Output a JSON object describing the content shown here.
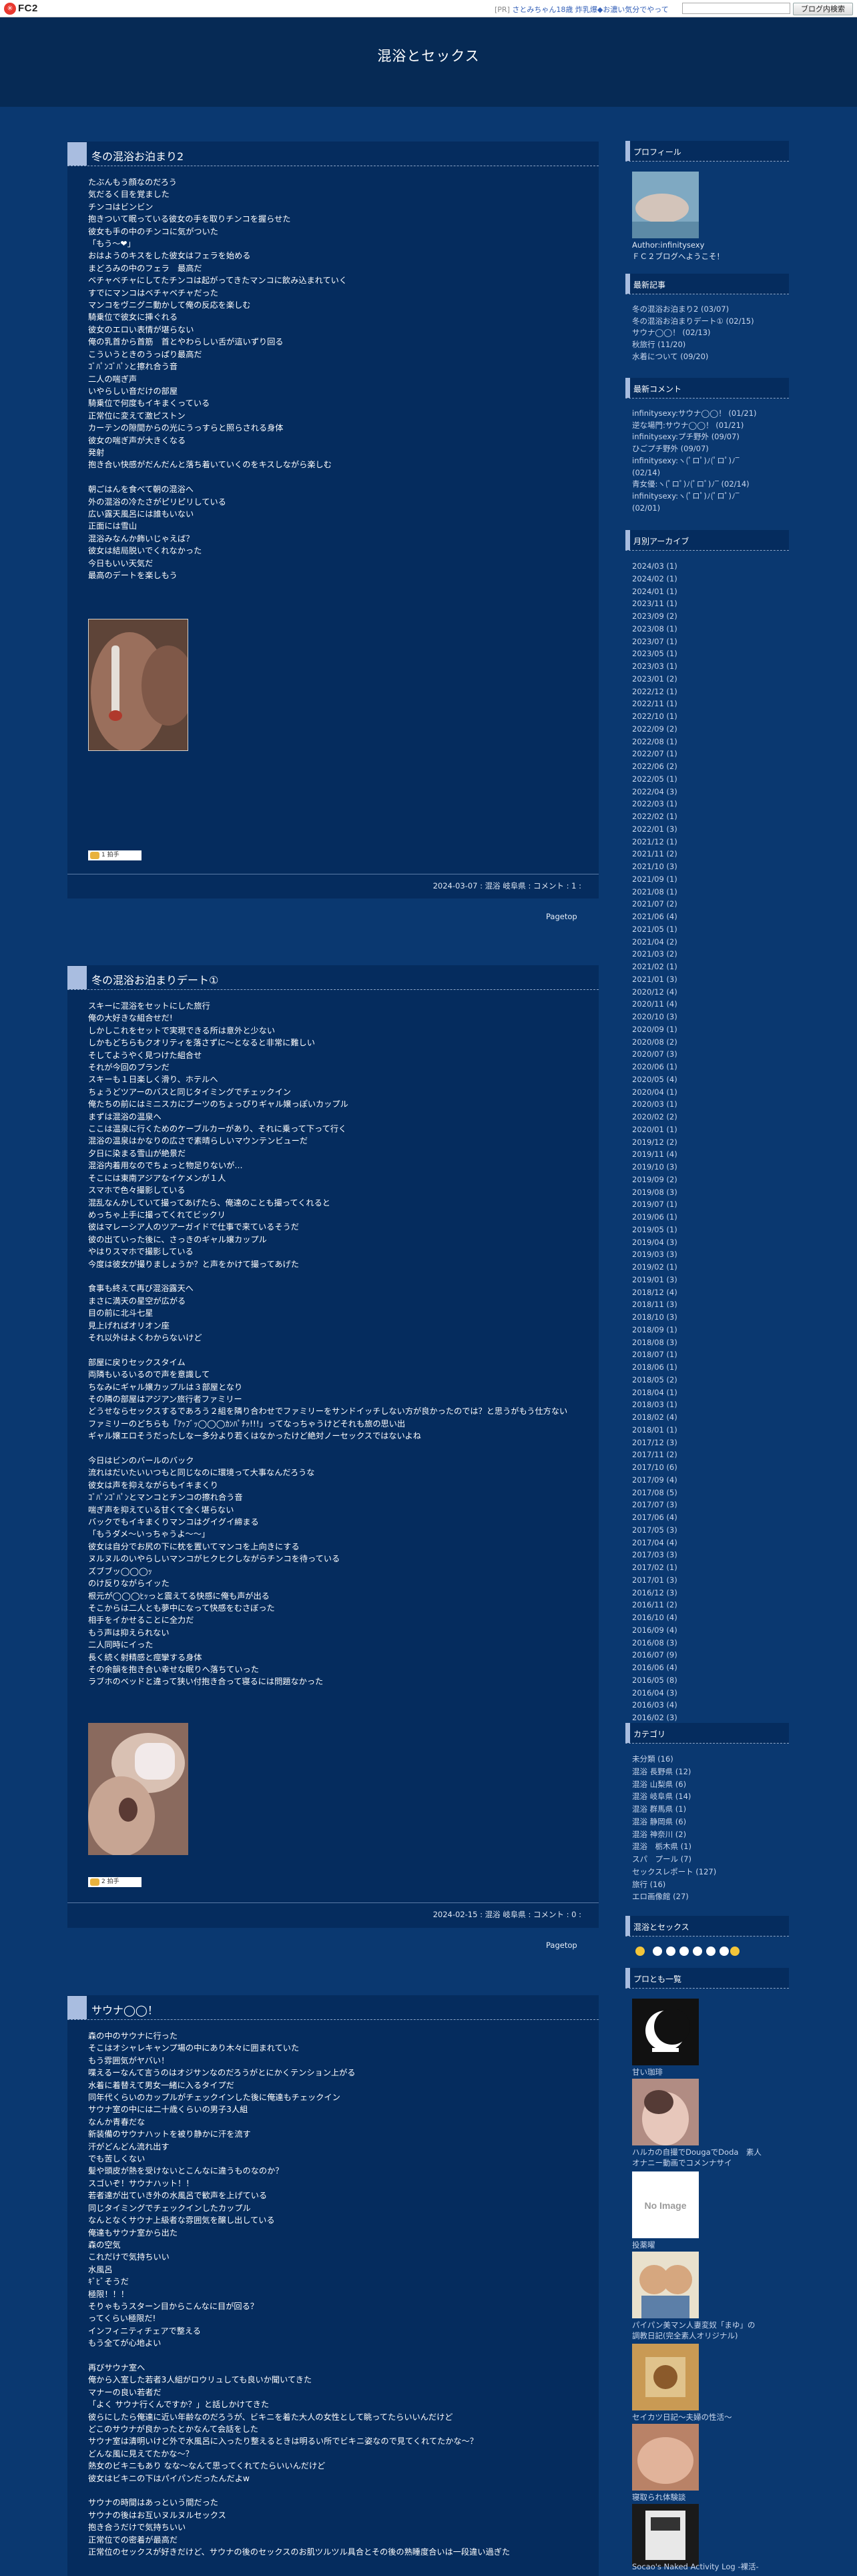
{
  "fc2bar": {
    "logo_text": "FC2",
    "ad_pr": "[PR]",
    "ad_text": " さとみちゃん18歳 炸乳爆◆お濃い気分でやって",
    "search_button": "ブログ内検索"
  },
  "blog": {
    "title": "混浴とセックス"
  },
  "entries": [
    {
      "title": "冬の混浴お泊まり2",
      "body": "たぶんもう顔なのだろう\n気だるく目を覚ました\nチンコはビンビン\n抱きついて眠っている彼女の手を取りチンコを握らせた\n彼女も手の中のチンコに気がついた\n「もう～❤」\nおはようのキスをした彼女はフェラを始める\nまどろみの中のフェラ　最高だ\nベチャベチャにしてたチンコは起がってきたマンコに飲み込まれていく\nすでにマンコはベチャベチャだった\nマンコをヴニグニ動かして俺の反応を楽しむ\n騎乗位で彼女に挿ぐれる\n彼女のエロい表情が堪らない\n俺の乳首から首筋　首とやわらしい舌が這いずり回る\nこういうときのうっぱり最高だ\nｺﾞﾊﾟﾝｺﾞﾊﾟﾝと擦れ合う音\n二人の喘ぎ声\nいやらしい音だけの部屋\n騎乗位で何度もイキまくっている\n正常位に変えて激ピストン\nカーテンの隙間からの光にうっすらと照らされる身体\n彼女の喘ぎ声が大きくなる\n発射\n抱き合い快感がだんだんと落ち着いていくのをキスしながら楽しむ\n\n朝ごはんを食べて朝の混浴へ\n外の混浴の冷たさがピリピリしている\n広い露天風呂には誰もいない\n正面には雪山\n混浴みなんか飾いじゃえば？\n彼女は結局脱いでくれなかった\n今日もいい天気だ\n最高のデートを楽しもう",
      "applause": "1 拍手",
      "meta": "2024-03-07 : 混浴 岐阜県 : コメント : 1 :"
    },
    {
      "title": "冬の混浴お泊まりデート①",
      "body": "スキーに混浴をセットにした旅行\n俺の大好きな組合せだ!\nしかしこれをセットで実現できる所は意外と少ない\nしかもどちらもクオリティを落さずに～となると非常に難しい\nそしてようやく見つけた組合せ\nそれが今回のプランだ\nスキーも１日楽しく滑り、ホテルへ\nちょうどツアーのバスと同じタイミングでチェックイン\n俺たちの前にはミニスカにブーツのちょっぴりギャル嬢っぽいカップル\nまずは混浴の温泉へ\nここは温泉に行くためのケーブルカーがあり、それに乗って下って行く\n混浴の温泉はかなりの広さで素晴らしいマウンテンビューだ\n夕日に染まる雪山が絶景だ\n混浴内着用なのでちょっと物足りないが…\nそこには東南アジアなイケメンが１人\nスマホで色々撮影している\n混乱なんかしていて撮ってあげたら、俺達のことも撮ってくれると\nめっちゃ上手に撮ってくれてビックリ\n彼はマレーシア人のツアーガイドで仕事で来ているそうだ\n彼の出ていった後に、さっきのギャル嬢カップル\nやはりスマホで撮影している\n今度は彼女が撮りましょうか？と声をかけて撮ってあげた\n\n食事も終えて再び混浴露天へ\nまさに満天の星空が広がる\n目の前に北斗七星\n見上げればオリオン座\nそれ以外はよくわからないけど\n\n部屋に戻りセックスタイム\n両隣もいるいるので声を意識して\nちなみにギャル嬢カップルは３部屋となり\nその隣の部屋はアジアン旅行者ファミリー\nどうせならセックスするであろう２組を隣り合わせでファミリーをサンドイッチしない方が良かったのでは？と思うがもう仕方ない\nファミリーのどちらも「ｱｯﾌﾞｯ◯◯◯ｶﾝﾊﾟﾁｯ!!!」ってなっちゃうけどそれも旅の思い出\nギャル嬢エロそうだったしなー多分より若くはなかったけど絶対ノーセックスではないよね\n\n今日はビンのバールのバック\n流れはだいたいいつもと同じなのに環境って大事なんだろうな\n彼女は声を抑えながらもイキまくり\nｺﾞﾊﾟﾝｺﾞﾊﾟﾝとマンコとチンコの擦れ合う音\n喘ぎ声を抑えている甘くて全く堪らない\nバックでもイキまくりマンコはグイグイ締まる\n「もうダメ～いっちゃうよ～～」\n彼女は自分でお尻の下に枕を置いてマンコを上向きにする\nヌルヌルのいやらしいマンコがヒクヒクしながらチンコを待っている\nズブブッ◯◯◯ｯ\nのけ反りながらイッた\n根元が◯◯◯ﾋｯっと震えてる快感に俺も声が出る\nそこからは二人とも夢中になって快感をむさぼった\n相手をイかせることに全力だ\nもう声は抑えられない\n二人同時にイった\n長く続く射精感と痙攣する身体\nその余韻を抱き合い幸せな眠りへ落ちていった\nラブホのベッドと違って狭い付抱き合って寝るには問題なかった",
      "applause": "2 拍手",
      "meta": "2024-02-15 : 混浴 岐阜県 : コメント : 0 :"
    },
    {
      "title": "サウナ◯◯！",
      "body": "森の中のサウナに行った\nそこはオシャレキャンプ場の中にあり木々に囲まれていた\nもう雰囲気がヤバい！\n喋えるーなんて言うのはオジサンなのだろうがとにかくテンション上がる\n水着に着替えて男女一緒に入るタイプだ\n同年代くらいのカップルがチェックインした後に俺達もチェックイン\nサウナ室の中には二十歳くらいの男子3人組\nなんか青春だな\n新装備のサウナハットを被り静かに汗を流す\n汗がどんどん流れ出す\nでも苦しくない\n髪や頭皮が熱を受けないとこんなに違うものなのか？\nスゴいぞ！サウナハット！！\n若者達が出ていき外の水風呂で歓声を上げている\n同じタイミングでチェックインしたカップル\nなんとなくサウナ上級者な雰囲気を醸し出している\n俺達もサウナ室から出た\n森の空気\nこれだけで気持ちいい\n水風呂\nｷﾞﾋﾞそうだ\n極限！！！\nそりゃもうスターン目からこんなに目が回る？\nってくらい極限だ!\nインフィニティチェアで整える\nもう全てが心地よい\n\n再びサウナ室へ\n俺から入室した若者3人組がロウリュしても良いか聞いてきた\nマナーの良い若者だ\n「よく サウナ行くんですか？」と話しかけてきた\n彼らにしたら俺達に近い年齢なのだろうが、ビキニを着た大人の女性として眺ってたらいいんだけど\nどこのサウナが良かったとかなんて会話をした\nサウナ室は清明いけど外で水風呂に入ったり整えるときは明るい所でビキニ姿なので見てくれてたかな～？\nどんな風に見えてたかな～？\n熱女のビキニもあり なな～なんて思ってくれてたらいいんだけど\n彼女はビキニの下はパイパンだったんだよw\n\nサウナの時間はあっという間だった\nサウナの後はお互いヌルヌルセックス\n抱き合うだけで気持ちいい\n正常位での密着が最高だ\n正常位のセックスが好きだけど、サウナの後のセックスのお肌ツルツル具合とその後の熟睡度合いは一段違い過ぎた",
      "applause": "",
      "meta": ""
    }
  ],
  "pagetop_label": "Pagetop",
  "sidebar": {
    "profile": {
      "title": "プロフィール",
      "author": "Author:infinitysexy",
      "greeting": "ＦＣ２ブログへようこそ！"
    },
    "recent_posts": {
      "title": "最新記事",
      "items": [
        "冬の混浴お泊まり2 (03/07)",
        "冬の混浴お泊まりデート① (02/15)",
        "サウナ◯◯！ (02/13)",
        "秋旅行 (11/20)",
        "水着について (09/20)"
      ]
    },
    "recent_comments": {
      "title": "最新コメント",
      "items": [
        "infinitysexy:サウナ◯◯！ (01/21)",
        "逆な場門:サウナ◯◯！ (01/21)",
        "infinitysexy:プチ野外 (09/07)",
        "ひごプチ野外 (09/07)",
        "infinitysexy:ヽ(ﾟロﾟ)ﾉ(ﾟロﾟ)ﾉ‾",
        "(02/14)",
        "青女優:ヽ(ﾟロﾟ)ﾉ(ﾟロﾟ)ﾉ‾ (02/14)",
        "infinitysexy:ヽ(ﾟロﾟ)ﾉ(ﾟロﾟ)ﾉ‾",
        "(02/01)"
      ]
    },
    "archive": {
      "title": "月別アーカイブ",
      "items": [
        "2024/03 (1)",
        "2024/02 (1)",
        "2024/01 (1)",
        "2023/11 (1)",
        "2023/09 (2)",
        "2023/08 (1)",
        "2023/07 (1)",
        "2023/05 (1)",
        "2023/03 (1)",
        "2023/01 (2)",
        "2022/12 (1)",
        "2022/11 (1)",
        "2022/10 (1)",
        "2022/09 (2)",
        "2022/08 (1)",
        "2022/07 (1)",
        "2022/06 (2)",
        "2022/05 (1)",
        "2022/04 (3)",
        "2022/03 (1)",
        "2022/02 (1)",
        "2022/01 (3)",
        "2021/12 (1)",
        "2021/11 (2)",
        "2021/10 (3)",
        "2021/09 (1)",
        "2021/08 (1)",
        "2021/07 (2)",
        "2021/06 (4)",
        "2021/05 (1)",
        "2021/04 (2)",
        "2021/03 (2)",
        "2021/02 (1)",
        "2021/01 (3)",
        "2020/12 (4)",
        "2020/11 (4)",
        "2020/10 (3)",
        "2020/09 (1)",
        "2020/08 (2)",
        "2020/07 (3)",
        "2020/06 (1)",
        "2020/05 (4)",
        "2020/04 (1)",
        "2020/03 (1)",
        "2020/02 (2)",
        "2020/01 (1)",
        "2019/12 (2)",
        "2019/11 (4)",
        "2019/10 (3)",
        "2019/09 (2)",
        "2019/08 (3)",
        "2019/07 (1)",
        "2019/06 (1)",
        "2019/05 (1)",
        "2019/04 (3)",
        "2019/03 (3)",
        "2019/02 (1)",
        "2019/01 (3)",
        "2018/12 (4)",
        "2018/11 (3)",
        "2018/10 (3)",
        "2018/09 (1)",
        "2018/08 (3)",
        "2018/07 (1)",
        "2018/06 (1)",
        "2018/05 (2)",
        "2018/04 (1)",
        "2018/03 (1)",
        "2018/02 (4)",
        "2018/01 (1)",
        "2017/12 (3)",
        "2017/11 (2)",
        "2017/10 (6)",
        "2017/09 (4)",
        "2017/08 (5)",
        "2017/07 (3)",
        "2017/06 (4)",
        "2017/05 (3)",
        "2017/04 (4)",
        "2017/03 (3)",
        "2017/02 (1)",
        "2017/01 (3)",
        "2016/12 (3)",
        "2016/11 (2)",
        "2016/10 (4)",
        "2016/09 (4)",
        "2016/08 (3)",
        "2016/07 (9)",
        "2016/06 (4)",
        "2016/05 (8)",
        "2016/04 (3)",
        "2016/03 (4)",
        "2016/02 (3)",
        "2016/01 (7)"
      ]
    },
    "categories": {
      "title": "カテゴリ",
      "items": [
        "未分類 (16)",
        "混浴 長野県 (12)",
        "混浴 山梨県 (6)",
        "混浴 岐阜県 (14)",
        "混浴 群馬県 (1)",
        "混浴 静岡県 (6)",
        "混浴 神奈川 (2)",
        "混浴　栃木県 (1)",
        "スパ　プール (7)",
        "セックスレポート (127)",
        "旅行 (16)",
        "エロ画像館 (27)"
      ]
    },
    "link_banner": {
      "title": "混浴とセックス"
    },
    "friends": {
      "title": "プロとも一覧",
      "items": [
        "甘い珈琲",
        "ハルカの自撮でDougaでDoda　素人",
        "オナニー動画でコメンナサイ",
        "投薬曜",
        "パイパン美マン人妻変奴「まゆ」の",
        "調教日記(完全素人オリジナル)",
        "セイカツ日記〜夫婦の性活〜",
        "寝取られ体験談",
        "Socao's Naked Activity Log -裸活-"
      ],
      "noimage_label": "No Image"
    }
  }
}
